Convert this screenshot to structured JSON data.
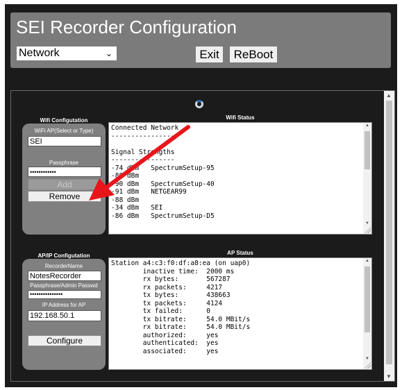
{
  "header": {
    "title": "SEI Recorder Configuration",
    "menu_selected": "Network",
    "exit_label": "Exit",
    "reboot_label": "ReBoot"
  },
  "wifi": {
    "section_title": "Wifi Configutation",
    "ap_label": "WiFi AP(Select or Type)",
    "ap_value": "SEI",
    "pass_label": "Passphrase",
    "pass_value": "••••••••••••",
    "add_label": "Add",
    "remove_label": "Remove",
    "status_title": "Wifi Status",
    "status_text": "Connected Network\n-----------------\n\nSignal Strengths\n----------------\n-74 dBm   SpectrumSetup-95\n-86 dBm\n-90 dBm   SpectrumSetup-40\n-91 dBm   NETGEAR99\n-88 dBm\n-34 dBm   SEI\n-86 dBm   SpectrumSetup-D5"
  },
  "ap": {
    "section_title": "AP/IP Configutation",
    "name_label": "RecorderName",
    "name_value": "NotesRecorder",
    "admin_label": "Passphrase/Admin Passwd",
    "admin_value": "•••••••••••••••",
    "ip_label": "IP Address for AP",
    "ip_value": "192.168.50.1",
    "configure_label": "Configure",
    "status_title": "AP Status",
    "status_text": "Station a4:c3:f0:df:a8:ea (on uap0)\n        inactive time:  2000 ms\n        rx bytes:       567287\n        rx packets:     4217\n        tx bytes:       438663\n        tx packets:     4124\n        tx failed:      0\n        tx bitrate:     54.0 MBit/s\n        rx bitrate:     54.0 MBit/s\n        authorized:     yes\n        authenticated:  yes\n        associated:     yes"
  },
  "colors": {
    "background": "#1b1b1b",
    "panel": "#808080",
    "header": "#7b7b7b",
    "annotation_arrow": "#e8161b"
  }
}
